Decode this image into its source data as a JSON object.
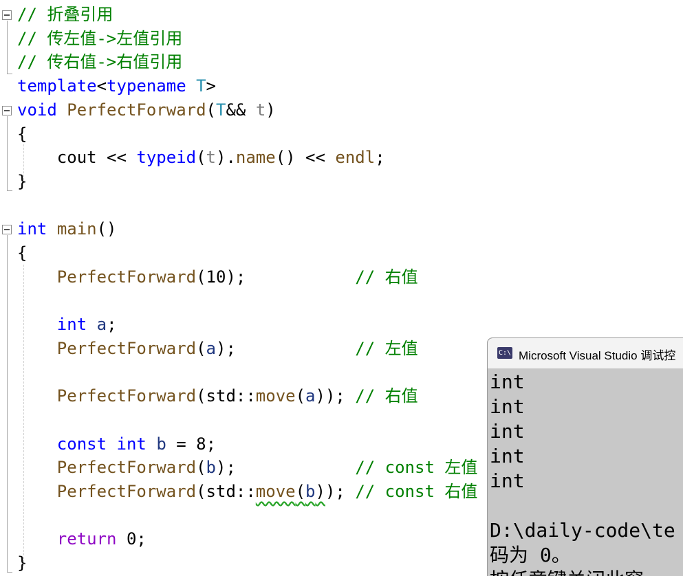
{
  "editor": {
    "lines": [
      {
        "id": "l1",
        "parts": [
          {
            "t": "// 折叠引用",
            "c": "cm"
          }
        ]
      },
      {
        "id": "l2",
        "parts": [
          {
            "t": "// 传左值->左值引用",
            "c": "cm"
          }
        ]
      },
      {
        "id": "l3",
        "parts": [
          {
            "t": "// 传右值->右值引用",
            "c": "cm"
          }
        ]
      },
      {
        "id": "l4",
        "parts": [
          {
            "t": "template",
            "c": "kw"
          },
          {
            "t": "<",
            "c": "df"
          },
          {
            "t": "typename",
            "c": "kw"
          },
          {
            "t": " ",
            "c": "df"
          },
          {
            "t": "T",
            "c": "tp"
          },
          {
            "t": ">",
            "c": "df"
          }
        ]
      },
      {
        "id": "l5",
        "parts": [
          {
            "t": "void",
            "c": "kw"
          },
          {
            "t": " ",
            "c": "df"
          },
          {
            "t": "PerfectForward",
            "c": "fn"
          },
          {
            "t": "(",
            "c": "df"
          },
          {
            "t": "T",
            "c": "tp"
          },
          {
            "t": "&& ",
            "c": "df"
          },
          {
            "t": "t",
            "c": "pm"
          },
          {
            "t": ")",
            "c": "df"
          }
        ]
      },
      {
        "id": "l6",
        "parts": [
          {
            "t": "{",
            "c": "df"
          }
        ]
      },
      {
        "id": "l7",
        "parts": [
          {
            "t": "    cout << ",
            "c": "df"
          },
          {
            "t": "typeid",
            "c": "kw"
          },
          {
            "t": "(",
            "c": "df"
          },
          {
            "t": "t",
            "c": "pm"
          },
          {
            "t": ").",
            "c": "df"
          },
          {
            "t": "name",
            "c": "fn"
          },
          {
            "t": "() << ",
            "c": "df"
          },
          {
            "t": "endl",
            "c": "fn"
          },
          {
            "t": ";",
            "c": "df"
          }
        ]
      },
      {
        "id": "l8",
        "parts": [
          {
            "t": "}",
            "c": "df"
          }
        ]
      },
      {
        "id": "l9",
        "parts": [
          {
            "t": "",
            "c": "df"
          }
        ]
      },
      {
        "id": "l10",
        "parts": [
          {
            "t": "int",
            "c": "kw"
          },
          {
            "t": " ",
            "c": "df"
          },
          {
            "t": "main",
            "c": "fn"
          },
          {
            "t": "()",
            "c": "df"
          }
        ]
      },
      {
        "id": "l11",
        "parts": [
          {
            "t": "{",
            "c": "df"
          }
        ]
      },
      {
        "id": "l12",
        "parts": [
          {
            "t": "    ",
            "c": "df"
          },
          {
            "t": "PerfectForward",
            "c": "fn"
          },
          {
            "t": "(10);           ",
            "c": "df"
          },
          {
            "t": "// 右值",
            "c": "cm"
          }
        ]
      },
      {
        "id": "l13",
        "parts": [
          {
            "t": "",
            "c": "df"
          }
        ]
      },
      {
        "id": "l14",
        "parts": [
          {
            "t": "    ",
            "c": "df"
          },
          {
            "t": "int",
            "c": "kw"
          },
          {
            "t": " ",
            "c": "df"
          },
          {
            "t": "a",
            "c": "var"
          },
          {
            "t": ";",
            "c": "df"
          }
        ]
      },
      {
        "id": "l15",
        "parts": [
          {
            "t": "    ",
            "c": "df"
          },
          {
            "t": "PerfectForward",
            "c": "fn"
          },
          {
            "t": "(",
            "c": "df"
          },
          {
            "t": "a",
            "c": "var"
          },
          {
            "t": ");            ",
            "c": "df"
          },
          {
            "t": "// 左值",
            "c": "cm"
          }
        ]
      },
      {
        "id": "l16",
        "parts": [
          {
            "t": "",
            "c": "df"
          }
        ]
      },
      {
        "id": "l17",
        "parts": [
          {
            "t": "    ",
            "c": "df"
          },
          {
            "t": "PerfectForward",
            "c": "fn"
          },
          {
            "t": "(std::",
            "c": "df"
          },
          {
            "t": "move",
            "c": "fn"
          },
          {
            "t": "(",
            "c": "df"
          },
          {
            "t": "a",
            "c": "var"
          },
          {
            "t": ")); ",
            "c": "df"
          },
          {
            "t": "// 右值",
            "c": "cm"
          }
        ]
      },
      {
        "id": "l18",
        "parts": [
          {
            "t": "",
            "c": "df"
          }
        ]
      },
      {
        "id": "l19",
        "parts": [
          {
            "t": "    ",
            "c": "df"
          },
          {
            "t": "const",
            "c": "kw"
          },
          {
            "t": " ",
            "c": "df"
          },
          {
            "t": "int",
            "c": "kw"
          },
          {
            "t": " ",
            "c": "df"
          },
          {
            "t": "b",
            "c": "var"
          },
          {
            "t": " = 8;",
            "c": "df"
          }
        ]
      },
      {
        "id": "l20",
        "parts": [
          {
            "t": "    ",
            "c": "df"
          },
          {
            "t": "PerfectForward",
            "c": "fn"
          },
          {
            "t": "(",
            "c": "df"
          },
          {
            "t": "b",
            "c": "var"
          },
          {
            "t": ");            ",
            "c": "df"
          },
          {
            "t": "// const 左值",
            "c": "cm"
          }
        ]
      },
      {
        "id": "l21",
        "parts": [
          {
            "t": "    ",
            "c": "df"
          },
          {
            "t": "PerfectForward",
            "c": "fn"
          },
          {
            "t": "(std::",
            "c": "df"
          },
          {
            "t": "move",
            "c": "fn",
            "sq": true
          },
          {
            "t": "(",
            "c": "df",
            "sq": true
          },
          {
            "t": "b",
            "c": "var",
            "sq": true
          },
          {
            "t": ")",
            "c": "df",
            "sq": true
          },
          {
            "t": "); ",
            "c": "df"
          },
          {
            "t": "// const 右值",
            "c": "cm"
          }
        ]
      },
      {
        "id": "l22",
        "parts": [
          {
            "t": "",
            "c": "df"
          }
        ]
      },
      {
        "id": "l23",
        "parts": [
          {
            "t": "    ",
            "c": "df"
          },
          {
            "t": "return",
            "c": "ct"
          },
          {
            "t": " 0;",
            "c": "df"
          }
        ]
      },
      {
        "id": "l24",
        "parts": [
          {
            "t": "}",
            "c": "df"
          }
        ]
      }
    ]
  },
  "console": {
    "icon_label": "C:\\",
    "title": "Microsoft Visual Studio 调试控",
    "lines": [
      "int",
      "int",
      "int",
      "int",
      "int",
      "",
      "D:\\daily-code\\te",
      "码为 0。",
      "按任意键关闭此窗"
    ]
  }
}
